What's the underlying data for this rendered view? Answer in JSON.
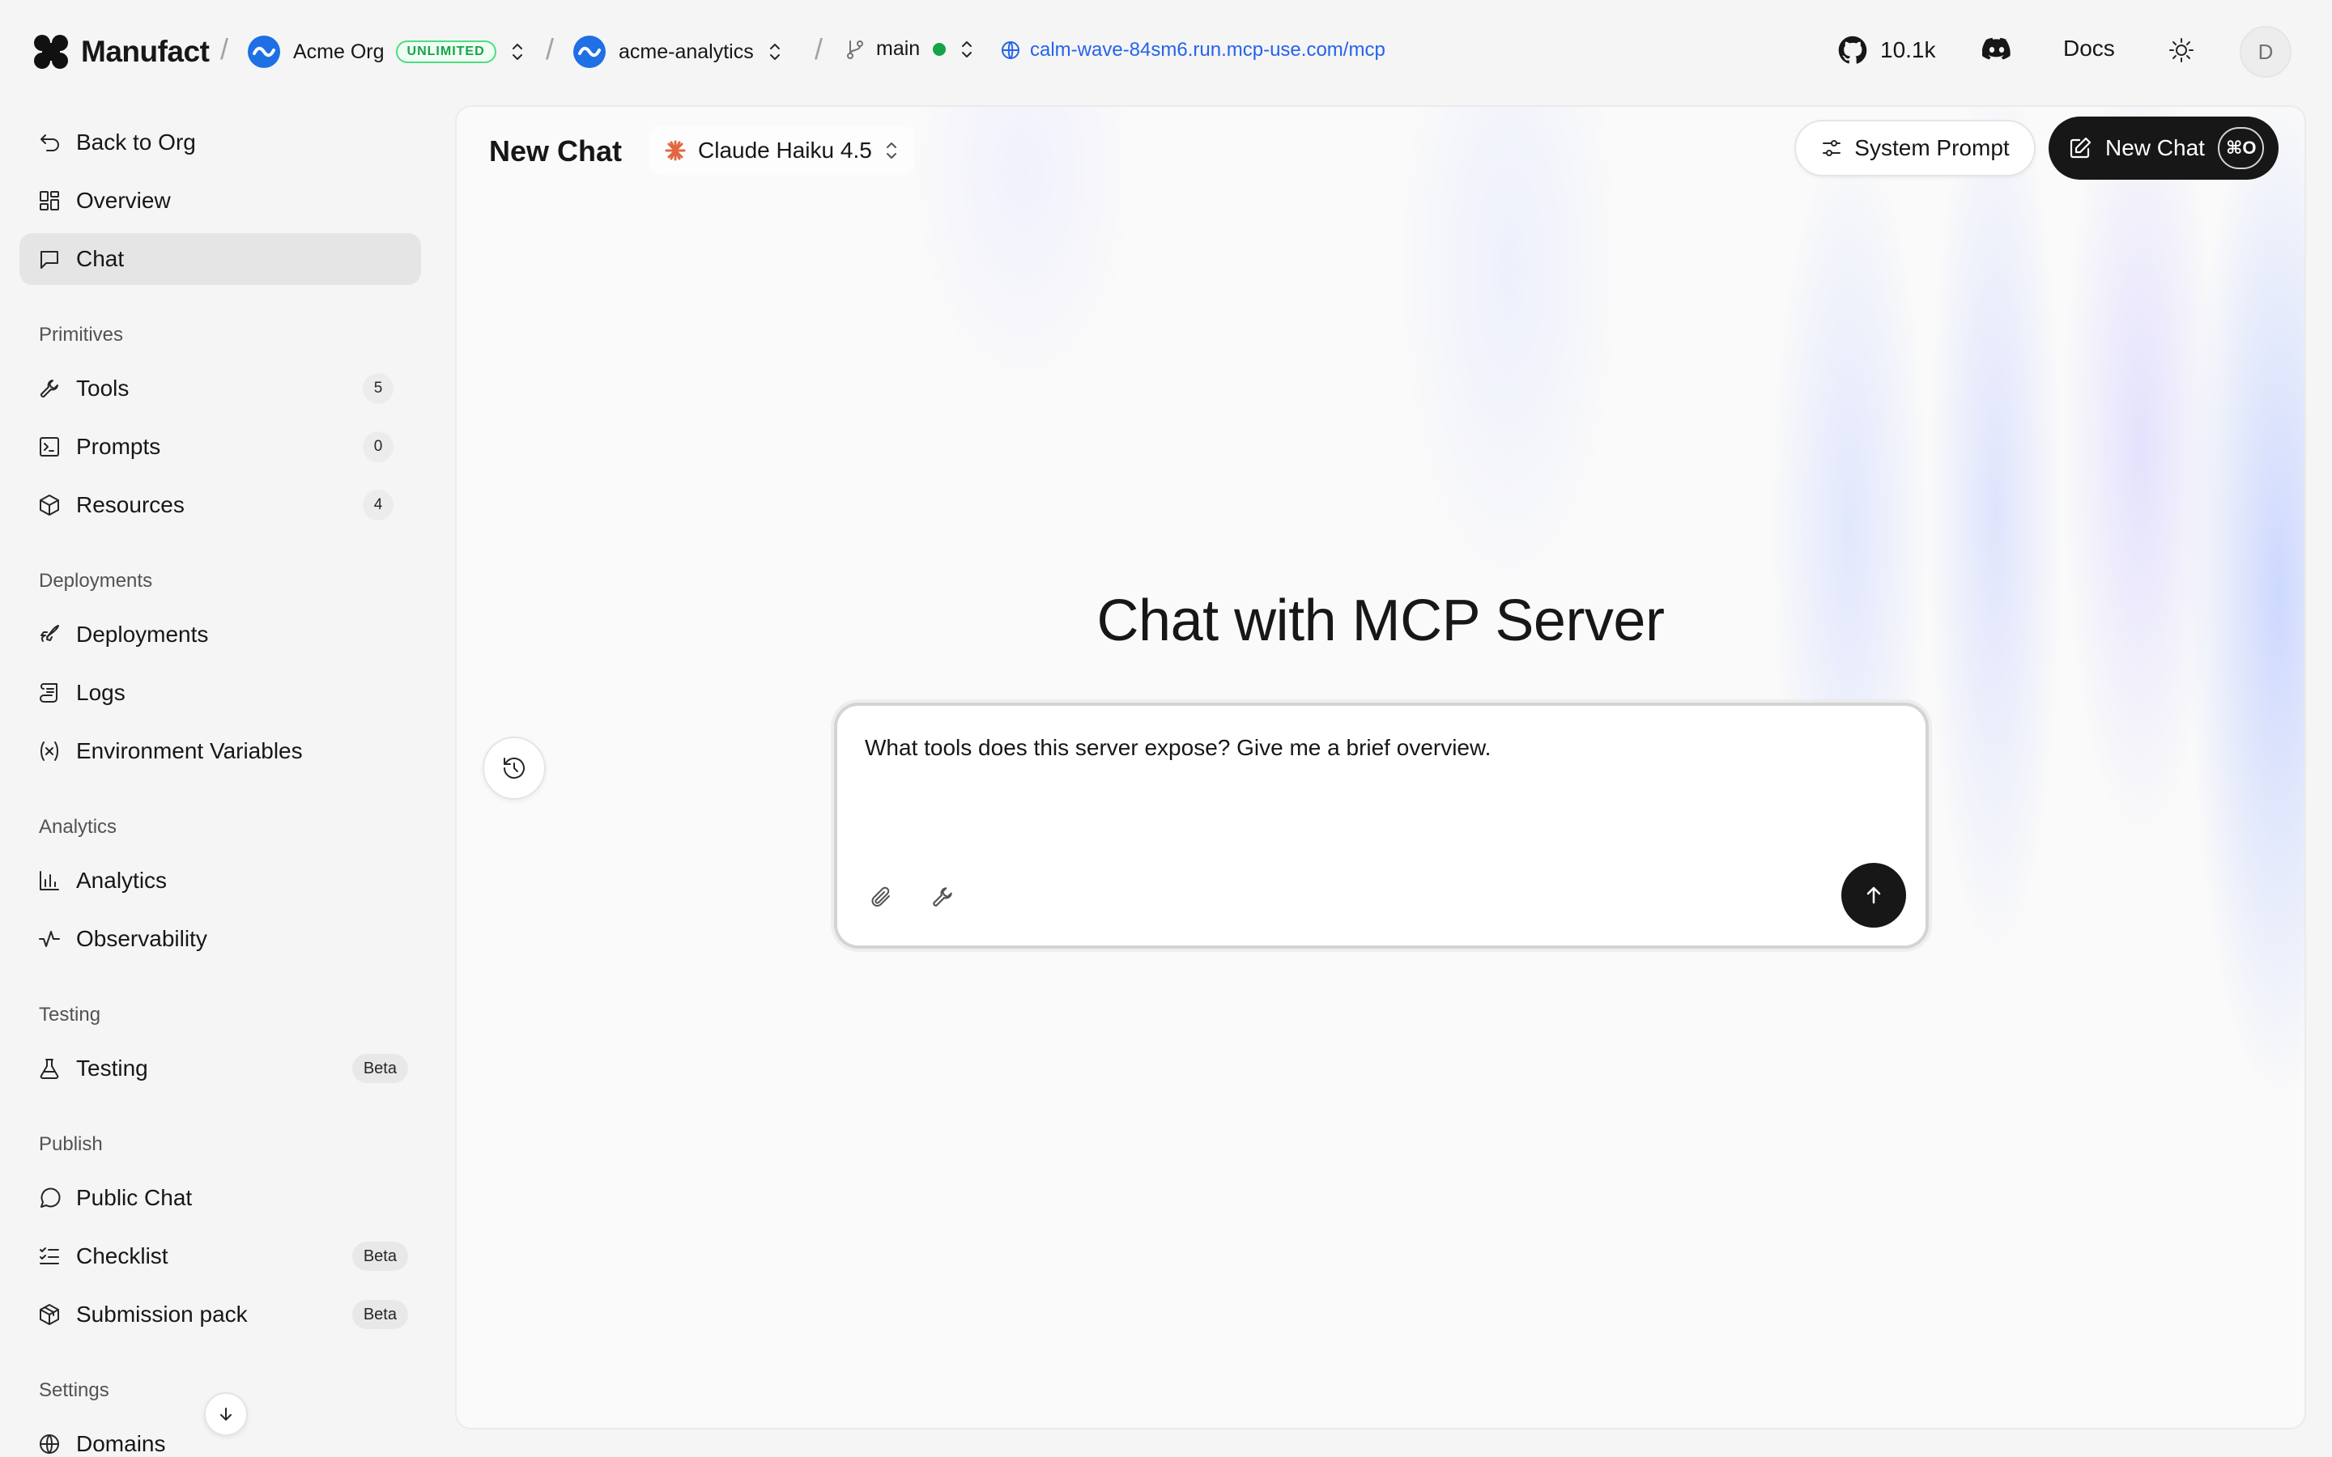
{
  "brand": {
    "name": "Manufact",
    "icon": "manufact-logo"
  },
  "breadcrumbs": {
    "org": {
      "name": "Acme Org",
      "plan_badge": "UNLIMITED"
    },
    "project": {
      "name": "acme-analytics"
    },
    "branch": {
      "name": "main",
      "status_color": "#16a34a"
    },
    "url": "calm-wave-84sm6.run.mcp-use.com/mcp"
  },
  "topbar": {
    "github_stars": "10.1k",
    "docs_label": "Docs",
    "avatar_initial": "D"
  },
  "sidebar": {
    "top": [
      {
        "label": "Back to Org",
        "icon": "back-icon"
      },
      {
        "label": "Overview",
        "icon": "dashboard-icon"
      },
      {
        "label": "Chat",
        "icon": "chat-icon",
        "active": true
      }
    ],
    "sections": [
      {
        "title": "Primitives",
        "items": [
          {
            "label": "Tools",
            "count": "5",
            "icon": "wrench-icon"
          },
          {
            "label": "Prompts",
            "count": "0",
            "icon": "terminal-icon"
          },
          {
            "label": "Resources",
            "count": "4",
            "icon": "box-icon"
          }
        ]
      },
      {
        "title": "Deployments",
        "items": [
          {
            "label": "Deployments",
            "icon": "rocket-icon"
          },
          {
            "label": "Logs",
            "icon": "scroll-icon"
          },
          {
            "label": "Environment Variables",
            "icon": "variable-icon"
          }
        ]
      },
      {
        "title": "Analytics",
        "items": [
          {
            "label": "Analytics",
            "icon": "bar-chart-icon"
          },
          {
            "label": "Observability",
            "icon": "activity-icon"
          }
        ]
      },
      {
        "title": "Testing",
        "items": [
          {
            "label": "Testing",
            "badge": "Beta",
            "icon": "flask-icon"
          }
        ]
      },
      {
        "title": "Publish",
        "items": [
          {
            "label": "Public Chat",
            "icon": "message-circle-icon"
          },
          {
            "label": "Checklist",
            "badge": "Beta",
            "icon": "list-checks-icon"
          },
          {
            "label": "Submission pack",
            "badge": "Beta",
            "icon": "package-icon"
          }
        ]
      },
      {
        "title": "Settings",
        "items": [
          {
            "label": "Domains",
            "icon": "globe-icon"
          }
        ]
      }
    ]
  },
  "main": {
    "title": "New Chat",
    "model": "Claude Haiku 4.5",
    "system_prompt_label": "System Prompt",
    "new_chat_label": "New Chat",
    "new_chat_shortcut": "⌘O",
    "heading": "Chat with MCP Server",
    "composer": {
      "value": "What tools does this server expose? Give me a brief overview."
    }
  },
  "colors": {
    "accent": "#171717",
    "link": "#2563eb",
    "org_icon": "#1f6fe5",
    "model_icon": "#e2673f",
    "status_green": "#16a34a"
  }
}
